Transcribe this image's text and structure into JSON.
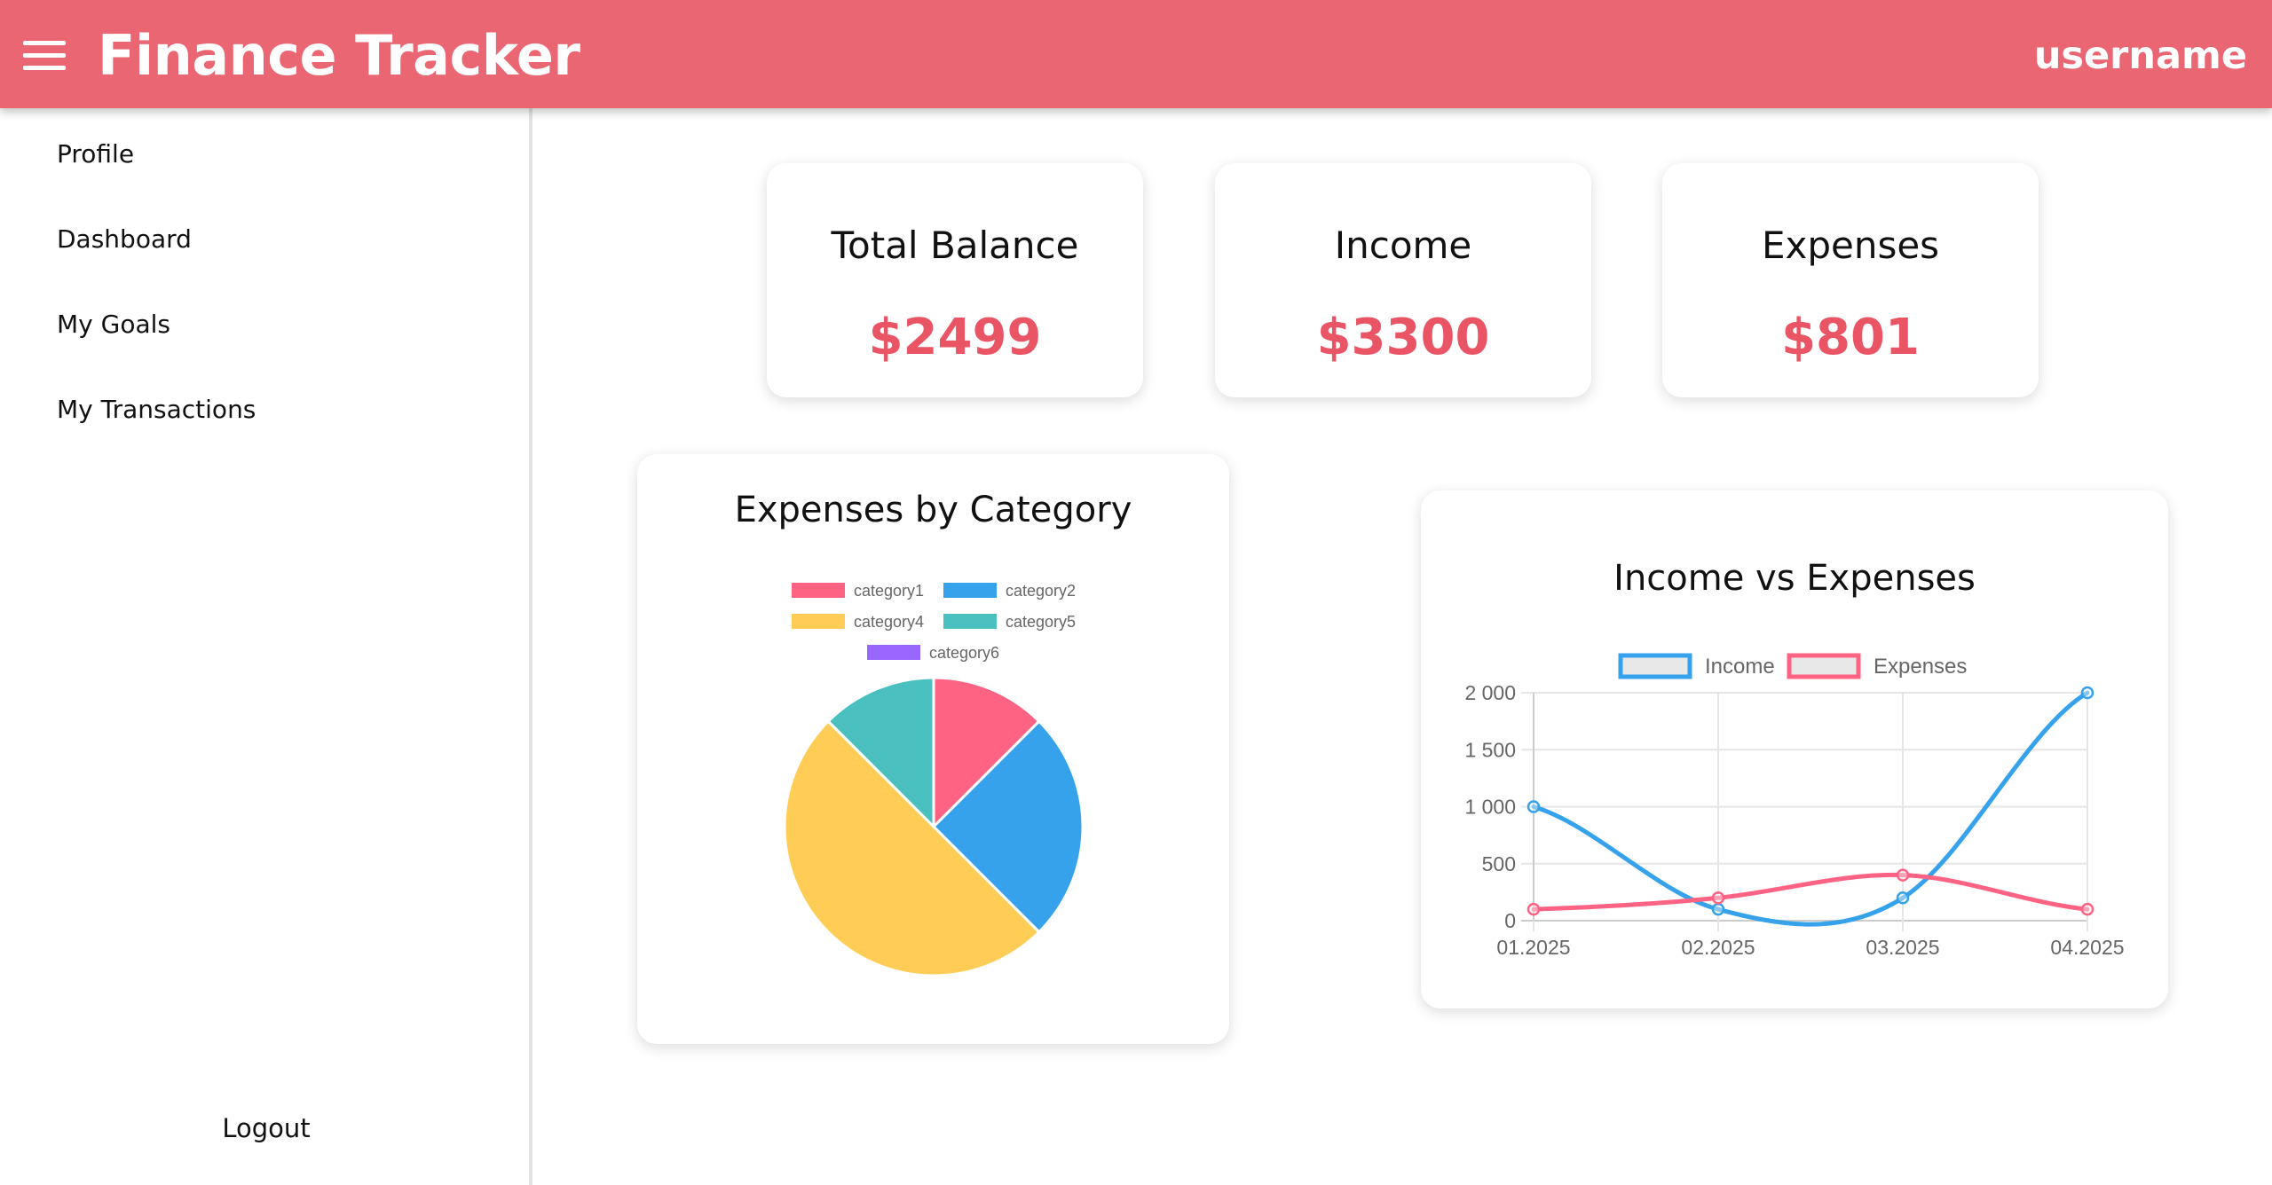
{
  "header": {
    "title": "Finance Tracker",
    "username": "username",
    "menu_icon": "hamburger-menu-icon",
    "color": "#ea6673"
  },
  "sidebar": {
    "items": [
      {
        "label": "Profile"
      },
      {
        "label": "Dashboard"
      },
      {
        "label": "My Goals"
      },
      {
        "label": "My Transactions"
      }
    ],
    "logout_label": "Logout"
  },
  "stats": [
    {
      "title": "Total Balance",
      "value": "$2499"
    },
    {
      "title": "Income",
      "value": "$3300"
    },
    {
      "title": "Expenses",
      "value": "$801"
    }
  ],
  "accent_color": "#ea5566",
  "chart_data": [
    {
      "type": "pie",
      "title": "Expenses by Category",
      "legend_position": "top",
      "labels": [
        "category1",
        "category2",
        "category4",
        "category5",
        "category6"
      ],
      "values": [
        100,
        200,
        400,
        100,
        0
      ],
      "colors": [
        "#ff6384",
        "#36a2eb",
        "#ffcd56",
        "#4bc0c0",
        "#9966ff"
      ]
    },
    {
      "type": "line",
      "title": "Income vs Expenses",
      "legend_position": "top",
      "x": [
        "01.2025",
        "02.2025",
        "03.2025",
        "04.2025"
      ],
      "series": [
        {
          "name": "Income",
          "values": [
            1000,
            100,
            200,
            2000
          ],
          "color": "#36a2eb"
        },
        {
          "name": "Expenses",
          "values": [
            100,
            200,
            400,
            100
          ],
          "color": "#ff6384"
        }
      ],
      "ylim": [
        0,
        2000
      ],
      "yticks": [
        "0",
        "500",
        "1 000",
        "1 500",
        "2 000"
      ],
      "grid": true
    }
  ]
}
